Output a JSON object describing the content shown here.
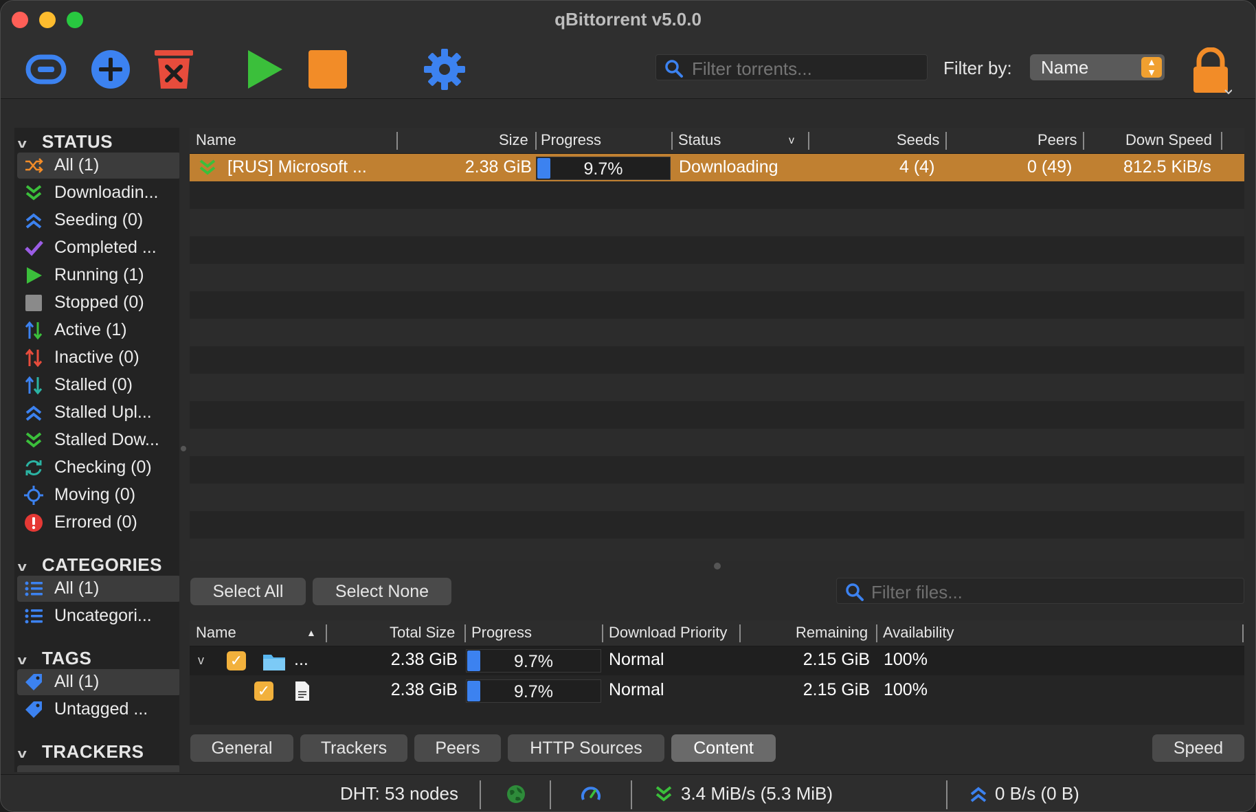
{
  "window": {
    "title": "qBittorrent v5.0.0"
  },
  "toolbar": {
    "buttons": [
      {
        "name": "add-link-button",
        "icon": "link-icon",
        "color": "#3c82f0"
      },
      {
        "name": "add-torrent-button",
        "icon": "plus-circle-icon",
        "color": "#3c82f0"
      },
      {
        "name": "remove-button",
        "icon": "trash-icon",
        "color": "#e74c3c"
      },
      {
        "name": "resume-button",
        "icon": "play-icon",
        "color": "#3bbf3b"
      },
      {
        "name": "stop-button",
        "icon": "stop-square-icon",
        "color": "#f28c28"
      },
      {
        "name": "options-button",
        "icon": "gear-icon",
        "color": "#3c82f0"
      }
    ],
    "search_placeholder": "Filter torrents...",
    "filter_by_label": "Filter by:",
    "filter_by_value": "Name",
    "lock_icon": "lock-icon"
  },
  "sidebar": {
    "status_header": "STATUS",
    "status_items": [
      {
        "label": "All (1)",
        "icon": "shuffle-icon",
        "selected": true
      },
      {
        "label": "Downloadin...",
        "icon": "download-chevron-icon"
      },
      {
        "label": "Seeding (0)",
        "icon": "upload-chevron-icon"
      },
      {
        "label": "Completed ...",
        "icon": "checkmark-icon"
      },
      {
        "label": "Running (1)",
        "icon": "play-icon"
      },
      {
        "label": "Stopped (0)",
        "icon": "stop-icon"
      },
      {
        "label": "Active (1)",
        "icon": "updown-arrows-icon"
      },
      {
        "label": "Inactive (0)",
        "icon": "updown-arrows-red-icon"
      },
      {
        "label": "Stalled (0)",
        "icon": "updown-arrows-teal-icon"
      },
      {
        "label": "Stalled Upl...",
        "icon": "upload-chevron-icon"
      },
      {
        "label": "Stalled Dow...",
        "icon": "download-chevron-icon"
      },
      {
        "label": "Checking (0)",
        "icon": "refresh-icon"
      },
      {
        "label": "Moving (0)",
        "icon": "crosshair-icon"
      },
      {
        "label": "Errored (0)",
        "icon": "error-icon"
      }
    ],
    "categories_header": "CATEGORIES",
    "category_items": [
      {
        "label": "All (1)",
        "icon": "list-icon",
        "selected": true
      },
      {
        "label": "Uncategori...",
        "icon": "list-icon"
      }
    ],
    "tags_header": "TAGS",
    "tag_items": [
      {
        "label": "All (1)",
        "icon": "tag-icon",
        "selected": true
      },
      {
        "label": "Untagged ...",
        "icon": "tag-icon"
      }
    ],
    "trackers_header": "TRACKERS"
  },
  "torrent_list": {
    "columns": [
      "Name",
      "Size",
      "Progress",
      "Status",
      "Seeds",
      "Peers",
      "Down Speed"
    ],
    "rows": [
      {
        "name": "[RUS] Microsoft ...",
        "size": "2.38 GiB",
        "progress_text": "9.7%",
        "progress": 0.097,
        "status": "Downloading",
        "seeds": "4 (4)",
        "peers": "0 (49)",
        "down_speed": "812.5 KiB/s",
        "icon": "download-chevron-icon"
      }
    ]
  },
  "content": {
    "select_all": "Select All",
    "select_none": "Select None",
    "filter_placeholder": "Filter files...",
    "columns": [
      "Name",
      "Total Size",
      "Progress",
      "Download Priority",
      "Remaining",
      "Availability"
    ],
    "rows": [
      {
        "name": "...",
        "type": "folder-icon",
        "total_size": "2.38 GiB",
        "progress_text": "9.7%",
        "progress": 0.097,
        "priority": "Normal",
        "remaining": "2.15 GiB",
        "availability": "100%"
      },
      {
        "name": "",
        "type": "file-icon",
        "total_size": "2.38 GiB",
        "progress_text": "9.7%",
        "progress": 0.097,
        "priority": "Normal",
        "remaining": "2.15 GiB",
        "availability": "100%"
      }
    ]
  },
  "tabs": {
    "items": [
      "General",
      "Trackers",
      "Peers",
      "HTTP Sources",
      "Content"
    ],
    "active": "Content",
    "speed": "Speed"
  },
  "statusbar": {
    "dht": "DHT: 53 nodes",
    "download": "3.4 MiB/s (5.3 MiB)",
    "upload": "0 B/s (0 B)"
  }
}
